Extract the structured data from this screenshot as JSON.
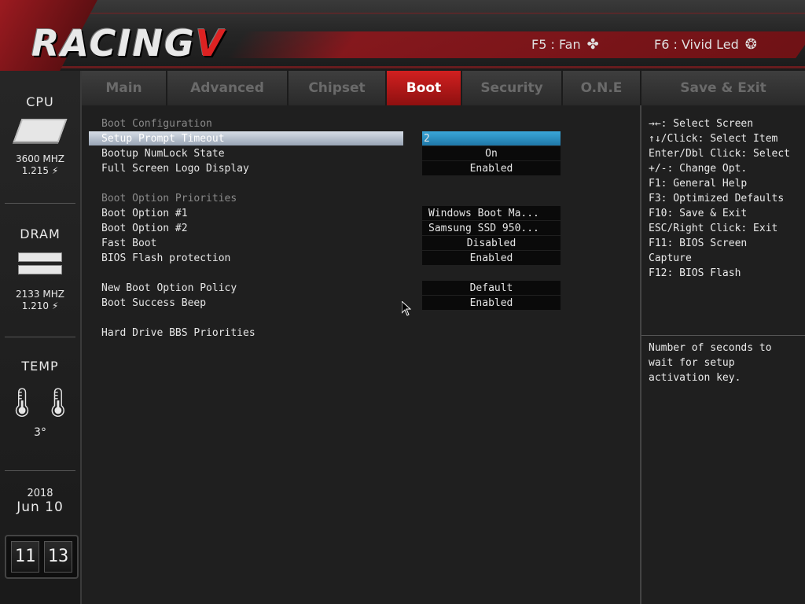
{
  "header": {
    "logo": "RACING",
    "logo_mark": "V",
    "f5_label": "F5 : Fan",
    "f6_label": "F6 : Vivid Led"
  },
  "sidebar": {
    "cpu": {
      "title": "CPU",
      "freq": "3600 MHZ",
      "volt": "1.215 ⚡"
    },
    "dram": {
      "title": "DRAM",
      "freq": "2133 MHZ",
      "volt": "1.210 ⚡"
    },
    "temp": {
      "title": "TEMP",
      "value": "3°"
    },
    "date": {
      "year": "2018",
      "day": "Jun 10"
    },
    "clock": {
      "hour": "11",
      "minute": "13"
    }
  },
  "tabs": [
    {
      "label": "Main",
      "active": false
    },
    {
      "label": "Advanced",
      "active": false
    },
    {
      "label": "Chipset",
      "active": false
    },
    {
      "label": "Boot",
      "active": true
    },
    {
      "label": "Security",
      "active": false
    },
    {
      "label": "O.N.E",
      "active": false
    },
    {
      "label": "Save & Exit",
      "active": false
    }
  ],
  "main": {
    "boot_config_header": "Boot Configuration",
    "setup_prompt": {
      "label": "Setup Prompt Timeout",
      "value": "2"
    },
    "numlock": {
      "label": "Bootup NumLock State",
      "value": "On"
    },
    "logo_display": {
      "label": "Full Screen Logo Display",
      "value": "Enabled"
    },
    "priorities_header": "Boot Option Priorities",
    "boot1": {
      "label": "Boot Option #1",
      "value": "Windows Boot Ma..."
    },
    "boot2": {
      "label": "Boot Option #2",
      "value": "Samsung SSD 950..."
    },
    "fast_boot": {
      "label": "Fast Boot",
      "value": "Disabled"
    },
    "flash_protect": {
      "label": "BIOS Flash protection",
      "value": "Enabled"
    },
    "new_policy": {
      "label": "New Boot Option Policy",
      "value": "Default"
    },
    "beep": {
      "label": "Boot Success Beep",
      "value": "Enabled"
    },
    "hdd_bbs": {
      "label": "Hard Drive BBS Priorities"
    }
  },
  "help": {
    "keys": [
      "→←: Select Screen",
      "↑↓/Click: Select Item",
      "Enter/Dbl Click: Select",
      "+/-: Change Opt.",
      "F1: General Help",
      "F3: Optimized Defaults",
      "F10: Save & Exit",
      "ESC/Right Click: Exit",
      "F11: BIOS Screen",
      "Capture",
      "F12: BIOS Flash"
    ],
    "description": [
      "Number of seconds to",
      "wait for setup",
      "activation key."
    ]
  }
}
